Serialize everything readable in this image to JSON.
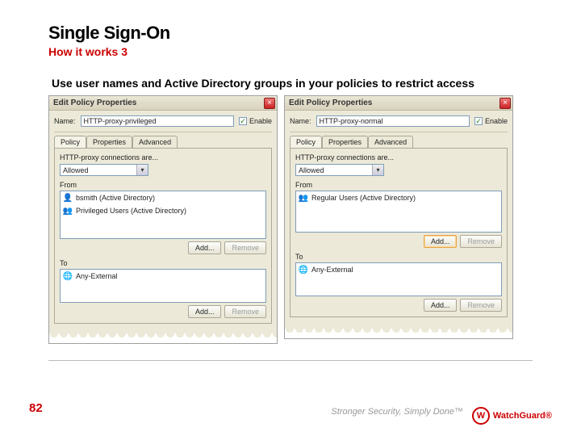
{
  "slide": {
    "title": "Single Sign-On",
    "subtitle": "How it works 3",
    "body": "Use user names and Active Directory groups in your policies to restrict access",
    "page_number": "82",
    "tagline": "Stronger Security, Simply Done™",
    "brand": "WatchGuard®"
  },
  "dialog_left": {
    "title": "Edit Policy Properties",
    "close_glyph": "×",
    "name_label": "Name:",
    "name_value": "HTTP-proxy-privileged",
    "enable_checked": "✓",
    "enable_label": "Enable",
    "tabs": [
      "Policy",
      "Properties",
      "Advanced"
    ],
    "connections_caption": "HTTP-proxy connections are...",
    "connections_value": "Allowed",
    "from_label": "From",
    "from_items": [
      {
        "icon": "👤",
        "text": "bsmith (Active Directory)"
      },
      {
        "icon": "👥",
        "text": "Privileged Users (Active Directory)"
      }
    ],
    "add_label": "Add...",
    "remove_label": "Remove",
    "to_label": "To",
    "to_items": [
      {
        "icon": "🌐",
        "text": "Any-External"
      }
    ]
  },
  "dialog_right": {
    "title": "Edit Policy Properties",
    "close_glyph": "×",
    "name_label": "Name:",
    "name_value": "HTTP-proxy-normal",
    "enable_checked": "✓",
    "enable_label": "Enable",
    "tabs": [
      "Policy",
      "Properties",
      "Advanced"
    ],
    "connections_caption": "HTTP-proxy connections are...",
    "connections_value": "Allowed",
    "from_label": "From",
    "from_items": [
      {
        "icon": "👥",
        "text": "Regular Users (Active Directory)"
      }
    ],
    "add_label": "Add...",
    "remove_label": "Remove",
    "to_label": "To",
    "to_items": [
      {
        "icon": "🌐",
        "text": "Any-External"
      }
    ]
  }
}
